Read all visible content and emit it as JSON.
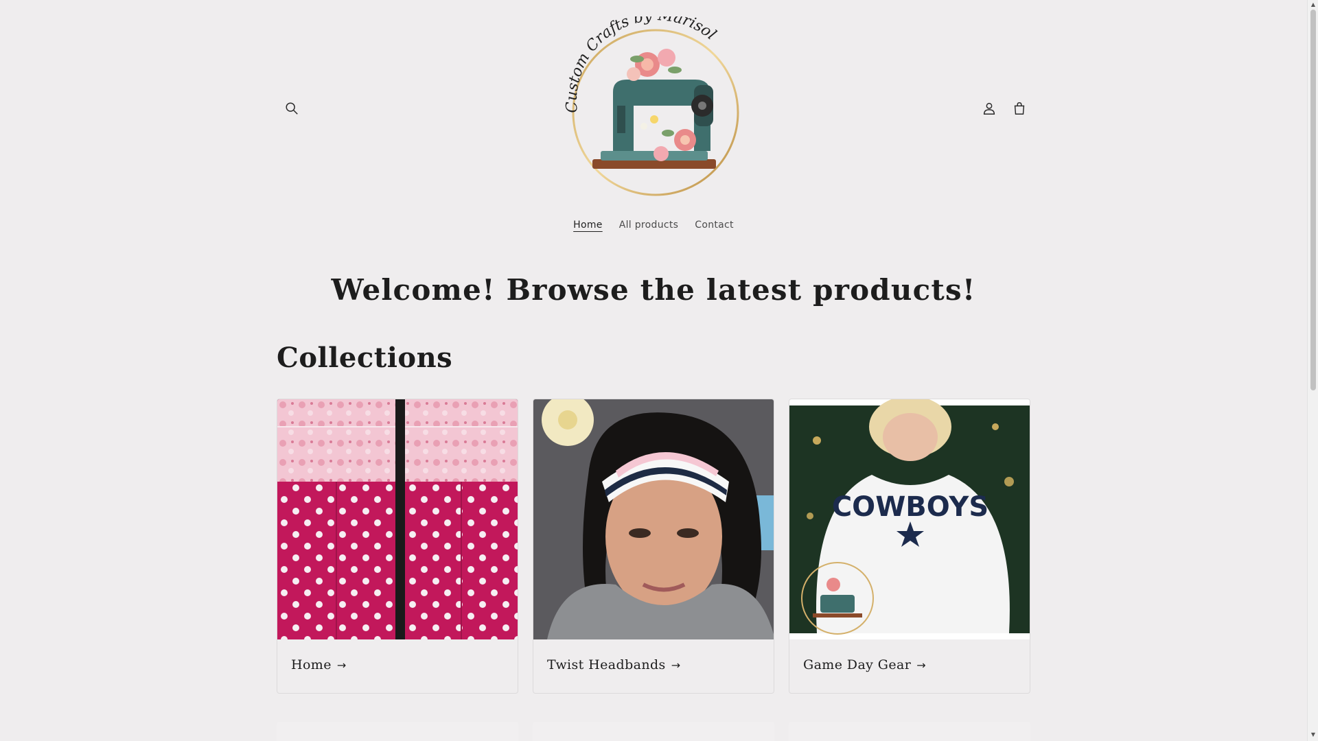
{
  "header": {
    "logo_text": "Custom Crafts by Marisol",
    "icons": {
      "search": "search-icon",
      "account": "account-icon",
      "cart": "cart-icon"
    }
  },
  "nav": {
    "items": [
      {
        "label": "Home",
        "active": true
      },
      {
        "label": "All products",
        "active": false
      },
      {
        "label": "Contact",
        "active": false
      }
    ]
  },
  "main": {
    "welcome": "Welcome! Browse the latest products!",
    "collections_title": "Collections",
    "collections": [
      {
        "label": "Home",
        "arrow": "→"
      },
      {
        "label": "Twist Headbands",
        "arrow": "→"
      },
      {
        "label": "Game Day Gear",
        "arrow": "→"
      }
    ],
    "sweater_text": "COWBOYS"
  },
  "colors": {
    "background": "#efedee",
    "text": "#1f1f1f",
    "magenta": "#c2185b",
    "pink_fabric": "#f3c6d3"
  }
}
